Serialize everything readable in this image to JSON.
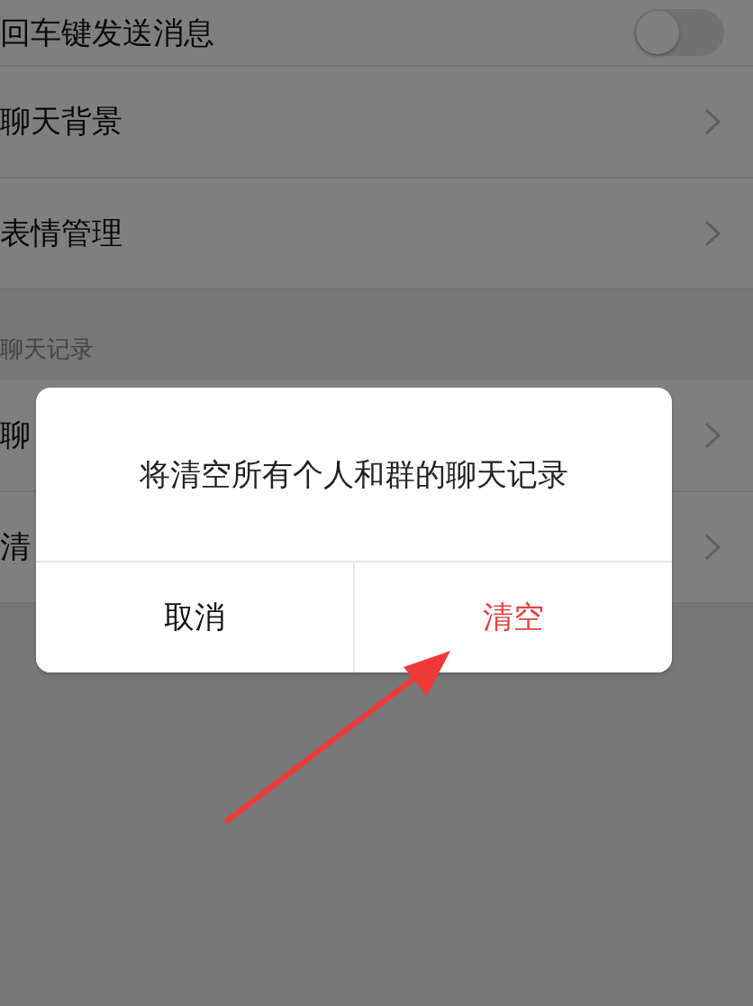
{
  "settings": [
    {
      "kind": "toggle",
      "label": "回车键发送消息",
      "on": false
    },
    {
      "kind": "link",
      "label": "聊天背景"
    },
    {
      "kind": "link",
      "label": "表情管理"
    },
    {
      "kind": "header",
      "label": "聊天记录"
    },
    {
      "kind": "link",
      "label": "聊"
    },
    {
      "kind": "link",
      "label": "清"
    }
  ],
  "dialog": {
    "message": "将清空所有个人和群的聊天记录",
    "buttons": [
      {
        "label": "取消",
        "kind": "cancel"
      },
      {
        "label": "清空",
        "kind": "destructive"
      }
    ]
  }
}
